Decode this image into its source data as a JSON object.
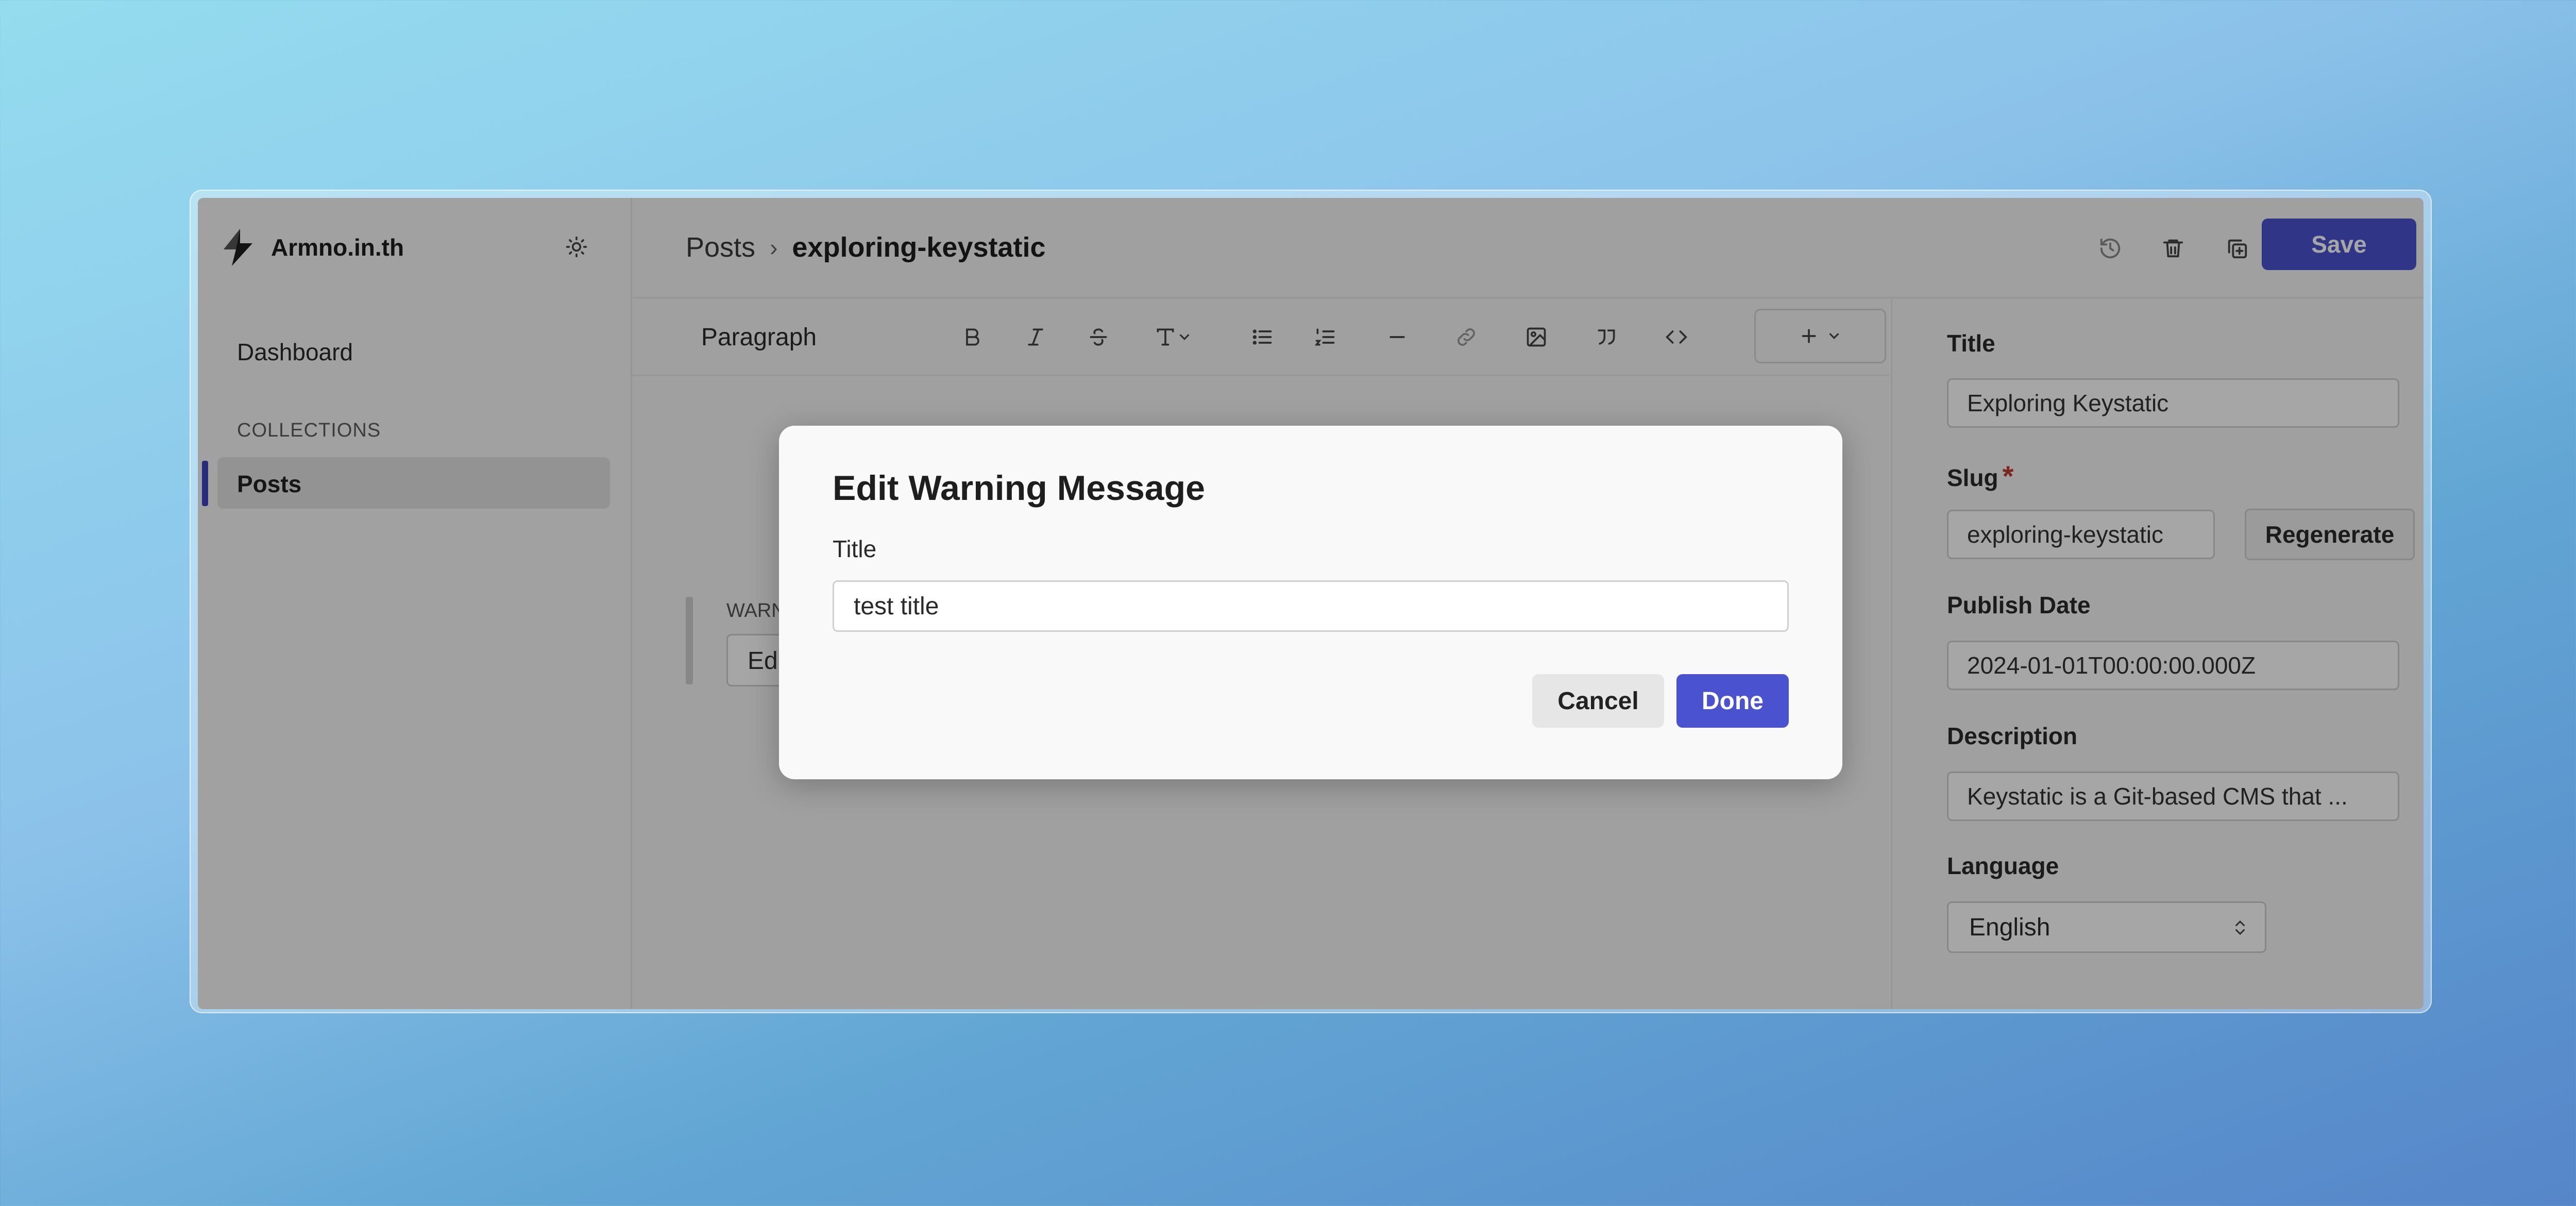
{
  "brand": {
    "name": "Armno.in.th",
    "logo_icon": "lightning-logo",
    "theme_icon": "sun-icon"
  },
  "sidebar": {
    "dashboard_label": "Dashboard",
    "section_label": "COLLECTIONS",
    "items": [
      {
        "label": "Posts",
        "active": true
      }
    ]
  },
  "header": {
    "breadcrumb_parent": "Posts",
    "breadcrumb_separator": "›",
    "breadcrumb_current": "exploring-keystatic",
    "icons": [
      "history-icon",
      "trash-icon",
      "duplicate-icon"
    ],
    "save_label": "Save"
  },
  "toolbar": {
    "block_type": "Paragraph",
    "tools": [
      "bold-icon",
      "italic-icon",
      "strikethrough-icon",
      "text-format-icon",
      "bullet-list-icon",
      "numbered-list-icon",
      "divider-icon",
      "link-icon",
      "image-icon",
      "quote-icon",
      "code-icon",
      "insert-icon"
    ]
  },
  "editor": {
    "block_label": "WARN",
    "block_field_text": "Edi"
  },
  "fields": {
    "title": {
      "label": "Title",
      "value": "Exploring Keystatic"
    },
    "slug": {
      "label": "Slug",
      "required_mark": "*",
      "value": "exploring-keystatic",
      "regenerate_label": "Regenerate"
    },
    "publish_date": {
      "label": "Publish Date",
      "value": "2024-01-01T00:00:00.000Z"
    },
    "description": {
      "label": "Description",
      "value": "Keystatic is a Git-based CMS that ..."
    },
    "language": {
      "label": "Language",
      "value": "English"
    }
  },
  "dialog": {
    "title": "Edit Warning Message",
    "field_label": "Title",
    "field_value": "test title",
    "cancel_label": "Cancel",
    "done_label": "Done"
  },
  "colors": {
    "accent": "#4a52cf",
    "active_bar": "#3d45b8"
  }
}
